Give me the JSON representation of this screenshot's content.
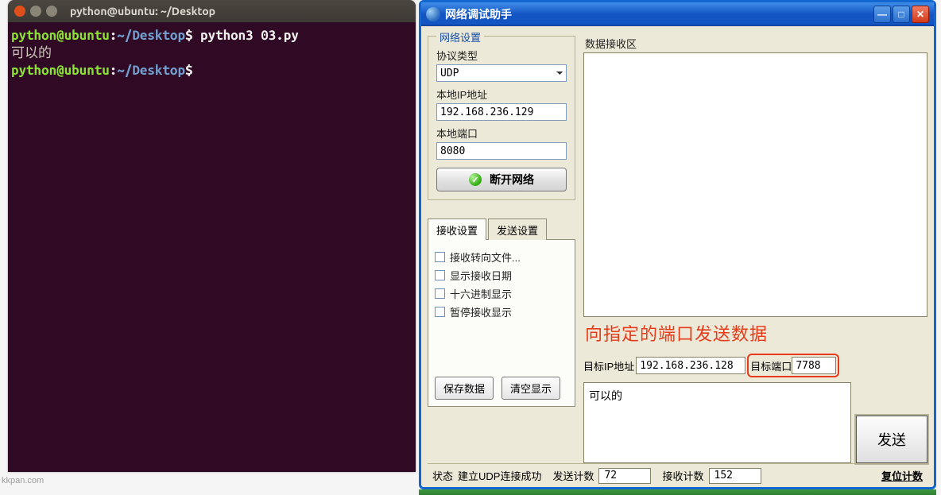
{
  "terminal": {
    "title": "python@ubuntu: ~/Desktop",
    "user": "python@ubuntu",
    "path": "~/Desktop",
    "prompt_sep": ":",
    "prompt_end": "$ ",
    "command1": "python3 03.py",
    "output1": "可以的",
    "command2": ""
  },
  "net": {
    "title": "网络调试助手",
    "group_title": "网络设置",
    "proto_label": "协议类型",
    "proto_value": "UDP",
    "localip_label": "本地IP地址",
    "localip_value": "192.168.236.129",
    "localport_label": "本地端口",
    "localport_value": "8080",
    "disconnect_label": "断开网络",
    "tab_recv": "接收设置",
    "tab_send": "发送设置",
    "chk_redirect": "接收转向文件...",
    "chk_showdate": "显示接收日期",
    "chk_hex": "十六进制显示",
    "chk_pause": "暂停接收显示",
    "btn_save": "保存数据",
    "btn_clear": "清空显示",
    "recv_title": "数据接收区",
    "annotation": "向指定的端口发送数据",
    "target_ip_label": "目标IP地址",
    "target_ip_value": "192.168.236.128",
    "target_port_label": "目标端口",
    "target_port_value": "7788",
    "msg_value": "可以的",
    "send_label": "发送",
    "status_label": "状态",
    "status_text": "建立UDP连接成功",
    "sendcnt_label": "发送计数",
    "sendcnt_value": "72",
    "recvcnt_label": "接收计数",
    "recvcnt_value": "152",
    "reset_label": "复位计数"
  },
  "watermark": "kkpan.com"
}
